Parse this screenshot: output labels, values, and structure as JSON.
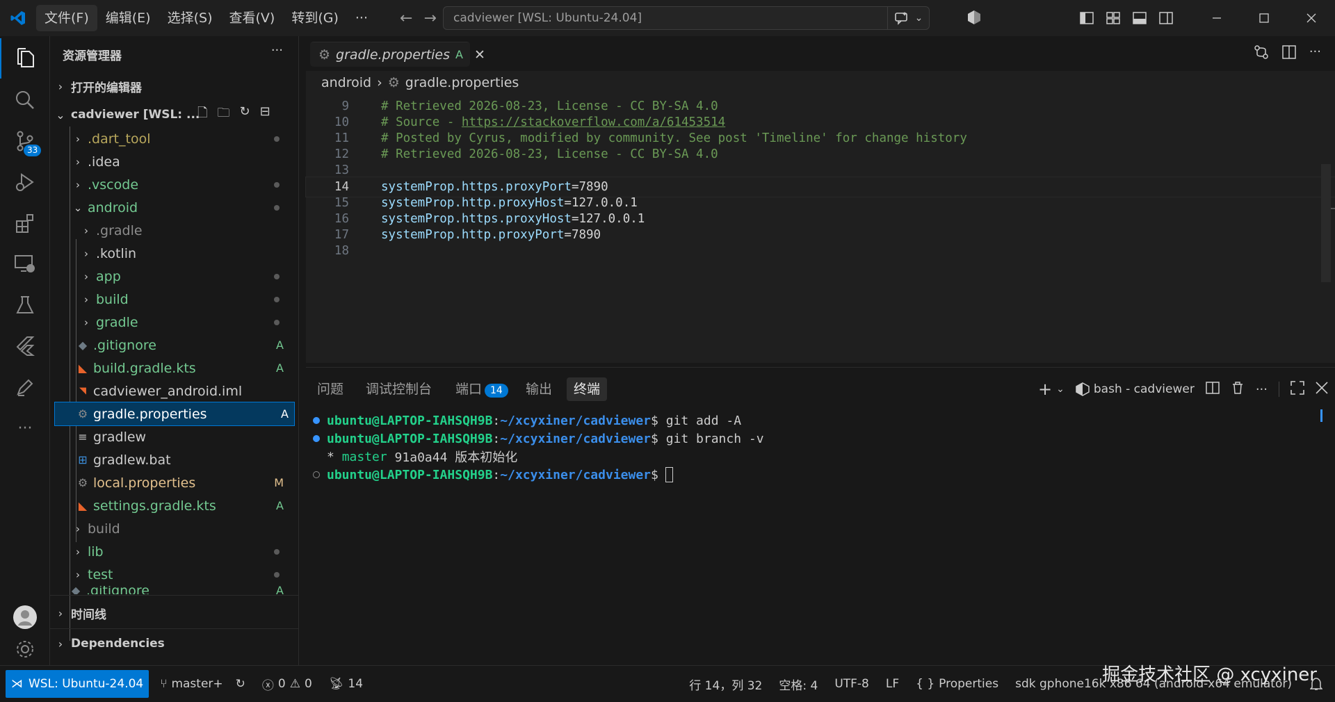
{
  "titlebar": {
    "menu": [
      "文件(F)",
      "编辑(E)",
      "选择(S)",
      "查看(V)",
      "转到(G)",
      "···"
    ],
    "command_center": "cadviewer [WSL: Ubuntu-24.04]"
  },
  "activity_bar": {
    "scm_badge": "33"
  },
  "sidebar": {
    "title": "资源管理器",
    "more": "···",
    "open_editors": "打开的编辑器",
    "workspace": "cadviewer [WSL: ...",
    "items": [
      {
        "label": ".dart_tool",
        "dec": ""
      },
      {
        "label": ".idea",
        "dec": ""
      },
      {
        "label": ".vscode",
        "dec": ""
      },
      {
        "label": "android",
        "dec": ""
      },
      {
        "label": ".gradle",
        "dec": ""
      },
      {
        "label": ".kotlin",
        "dec": ""
      },
      {
        "label": "app",
        "dec": ""
      },
      {
        "label": "build",
        "dec": ""
      },
      {
        "label": "gradle",
        "dec": ""
      },
      {
        "label": ".gitignore",
        "dec": "A"
      },
      {
        "label": "build.gradle.kts",
        "dec": "A"
      },
      {
        "label": "cadviewer_android.iml",
        "dec": ""
      },
      {
        "label": "gradle.properties",
        "dec": "A"
      },
      {
        "label": "gradlew",
        "dec": ""
      },
      {
        "label": "gradlew.bat",
        "dec": ""
      },
      {
        "label": "local.properties",
        "dec": "M"
      },
      {
        "label": "settings.gradle.kts",
        "dec": "A"
      },
      {
        "label": "build",
        "dec": ""
      },
      {
        "label": "lib",
        "dec": ""
      },
      {
        "label": "test",
        "dec": ""
      },
      {
        "label": ".gitignore",
        "dec": "A"
      }
    ],
    "timeline": "时间线",
    "dependencies": "Dependencies"
  },
  "editor": {
    "tab_label": "gradle.properties",
    "tab_status": "A",
    "breadcrumb_folder": "android",
    "breadcrumb_file": "gradle.properties",
    "lines": [
      {
        "n": "9",
        "text": "# Retrieved 2026-08-23, License - CC BY-SA 4.0"
      },
      {
        "n": "10",
        "text": "# Source - ",
        "link": "https://stackoverflow.com/a/61453514"
      },
      {
        "n": "11",
        "text": "# Posted by Cyrus, modified by community. See post 'Timeline' for change history"
      },
      {
        "n": "12",
        "text": "# Retrieved 2026-08-23, License - CC BY-SA 4.0"
      },
      {
        "n": "13",
        "text": ""
      },
      {
        "n": "14",
        "key": "systemProp.https.proxyPort",
        "val": "7890"
      },
      {
        "n": "15",
        "key": "systemProp.http.proxyHost",
        "val": "127.0.0.1"
      },
      {
        "n": "16",
        "key": "systemProp.https.proxyHost",
        "val": "127.0.0.1"
      },
      {
        "n": "17",
        "key": "systemProp.http.proxyPort",
        "val": "7890"
      },
      {
        "n": "18",
        "text": ""
      }
    ]
  },
  "panel": {
    "tabs": [
      "问题",
      "调试控制台",
      "端口",
      "输出",
      "终端"
    ],
    "ports_badge": "14",
    "terminal_name": "bash - cadviewer",
    "prompt_user": "ubuntu@LAPTOP-IAHSQH9B",
    "prompt_path": "~/xcyxiner/cadviewer",
    "cmd1": "git add -A",
    "cmd2": "git branch -v",
    "out_star": "* ",
    "out_branch": "master",
    "out_rest": " 91a0a44 版本初始化"
  },
  "statusbar": {
    "remote": "WSL: Ubuntu-24.04",
    "branch": "master+",
    "errors": "0",
    "warnings": "0",
    "ports": "14",
    "position": "行 14，列 32",
    "spaces": "空格: 4",
    "encoding": "UTF-8",
    "eol": "LF",
    "language": "Properties",
    "device": "sdk gphone16k x86 64 (android-x64 emulator)"
  },
  "watermark": "掘金技术社区 @ xcyxiner"
}
